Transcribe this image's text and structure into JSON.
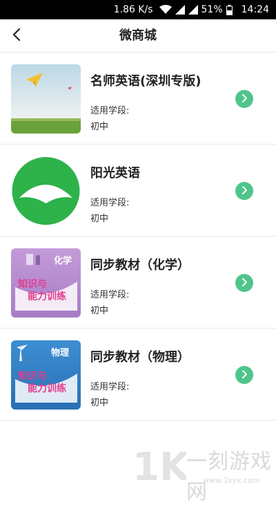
{
  "status_bar": {
    "speed": "1.86 K/s",
    "battery": "51%",
    "time": "14:24"
  },
  "header": {
    "title": "微商城"
  },
  "items": [
    {
      "name": "名师英语(深圳专版)",
      "stage_label": "适用学段:",
      "stage_value": "初中"
    },
    {
      "name": "阳光英语",
      "stage_label": "适用学段:",
      "stage_value": "初中"
    },
    {
      "name": "同步教材（化学）",
      "stage_label": "适用学段:",
      "stage_value": "初中"
    },
    {
      "name": "同步教材（物理）",
      "stage_label": "适用学段:",
      "stage_value": "初中"
    }
  ],
  "covers": {
    "chemistry_subject": "化学",
    "physics_subject": "物理",
    "book_title_line1": "知识与",
    "book_title_line2": "能力训练"
  },
  "watermark": {
    "logo_text": "1K",
    "brand": "一刻游戏网",
    "url": "www.1kyx.com"
  },
  "colors": {
    "accent_green": "#4fc58a",
    "status_bar_bg": "#000000"
  }
}
